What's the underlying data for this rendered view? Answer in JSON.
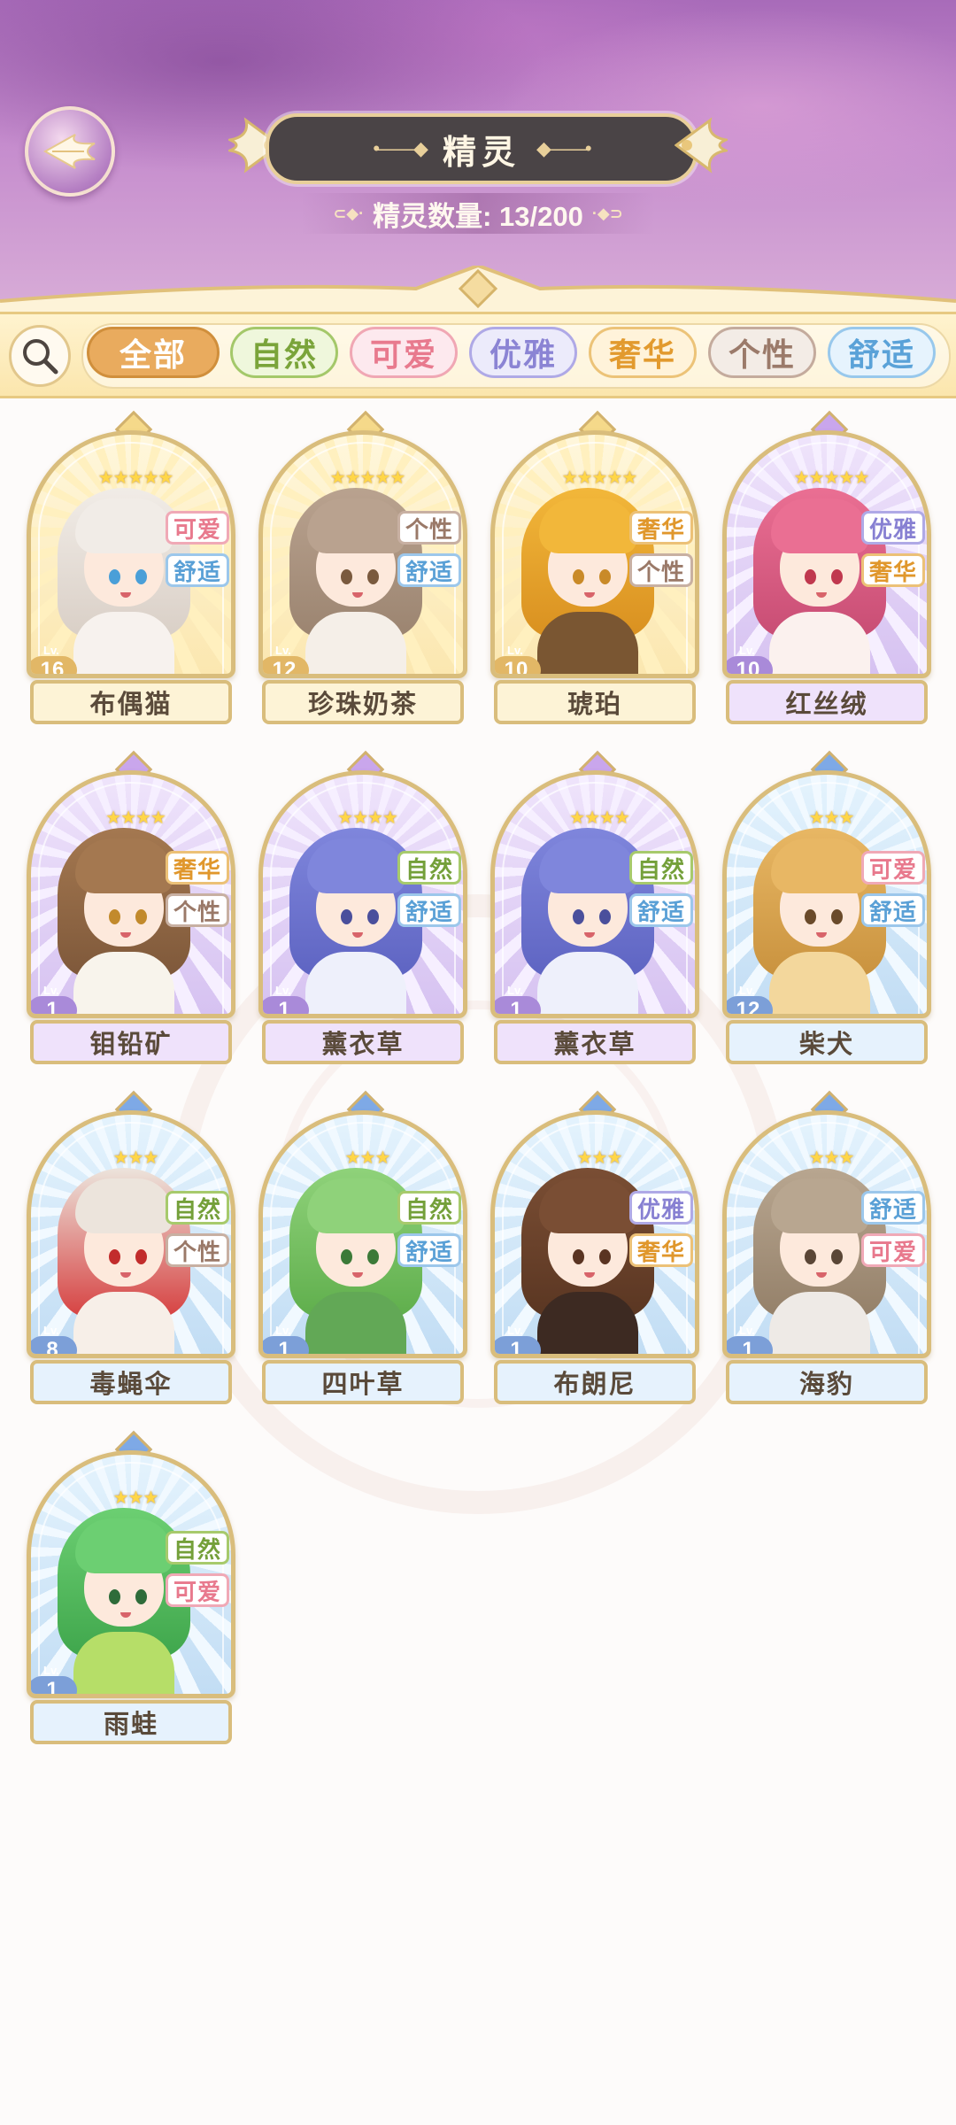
{
  "header": {
    "title": "精灵",
    "count_label": "精灵数量: 13/200"
  },
  "filters": {
    "items": [
      {
        "label": "全部",
        "text": "#ffffff",
        "bg": "#e9ab5e",
        "border": "#d08f3c"
      },
      {
        "label": "自然",
        "text": "#7aa43a",
        "bg": "#eff7dc",
        "border": "#a4c86a"
      },
      {
        "label": "可爱",
        "text": "#e87a8e",
        "bg": "#fde9ee",
        "border": "#f0a7b4"
      },
      {
        "label": "优雅",
        "text": "#8b84d4",
        "bg": "#ecebfb",
        "border": "#afa9e6"
      },
      {
        "label": "奢华",
        "text": "#e29a2e",
        "bg": "#fff3da",
        "border": "#ecc378"
      },
      {
        "label": "个性",
        "text": "#9b7a6a",
        "bg": "#f3ece6",
        "border": "#c4ab9d"
      },
      {
        "label": "舒适",
        "text": "#5aa2d8",
        "bg": "#e6f3fd",
        "border": "#98c8ec"
      }
    ]
  },
  "tag_colors": {
    "可爱": {
      "text": "#e8798d",
      "border": "#f0a9b6"
    },
    "舒适": {
      "text": "#5aa0d6",
      "border": "#9cc7eb"
    },
    "个性": {
      "text": "#9a7968",
      "border": "#c8b0a2"
    },
    "奢华": {
      "text": "#e0972c",
      "border": "#ecc177"
    },
    "优雅": {
      "text": "#8780d2",
      "border": "#afa9e6"
    },
    "自然": {
      "text": "#74a03a",
      "border": "#a7ca6c"
    }
  },
  "spirits": [
    {
      "name": "布偶猫",
      "level": "16",
      "stars": "★★★★★",
      "tags": [
        "可爱",
        "舒适"
      ],
      "rarity": "gold",
      "hair": "#f1ece7",
      "hair_shade": "#d9cfc6",
      "eye": "#4a9fd8",
      "body": "#f7f2ee"
    },
    {
      "name": "珍珠奶茶",
      "level": "12",
      "stars": "★★★★★",
      "tags": [
        "个性",
        "舒适"
      ],
      "rarity": "gold",
      "hair": "#b9a28f",
      "hair_shade": "#9b8470",
      "eye": "#7a5a3e",
      "body": "#f5efe8"
    },
    {
      "name": "琥珀",
      "level": "10",
      "stars": "★★★★★",
      "tags": [
        "奢华",
        "个性"
      ],
      "rarity": "gold",
      "hair": "#f2b73a",
      "hair_shade": "#d99020",
      "eye": "#c98a28",
      "body": "#7a5632"
    },
    {
      "name": "红丝绒",
      "level": "10",
      "stars": "★★★★★",
      "tags": [
        "优雅",
        "奢华"
      ],
      "rarity": "purple",
      "hair": "#ea6f93",
      "hair_shade": "#c84d74",
      "eye": "#c0384e",
      "body": "#fbf1ee"
    },
    {
      "name": "钼铅矿",
      "level": "1",
      "stars": "★★★★",
      "tags": [
        "奢华",
        "个性"
      ],
      "rarity": "purple",
      "hair": "#a47850",
      "hair_shade": "#7e583a",
      "eye": "#c28a2c",
      "body": "#f8f4ec"
    },
    {
      "name": "薰衣草",
      "level": "1",
      "stars": "★★★★",
      "tags": [
        "自然",
        "舒适"
      ],
      "rarity": "purple",
      "hair": "#7f86dc",
      "hair_shade": "#5e64c2",
      "eye": "#4a4f9c",
      "body": "#eef0fb"
    },
    {
      "name": "薰衣草",
      "level": "1",
      "stars": "★★★★",
      "tags": [
        "自然",
        "舒适"
      ],
      "rarity": "purple",
      "hair": "#7f86dc",
      "hair_shade": "#5e64c2",
      "eye": "#4a4f9c",
      "body": "#eef0fb"
    },
    {
      "name": "柴犬",
      "level": "12",
      "stars": "★★★",
      "tags": [
        "可爱",
        "舒适"
      ],
      "rarity": "blue",
      "hair": "#e8b764",
      "hair_shade": "#c9923e",
      "eye": "#6a4a2a",
      "body": "#f3d79c"
    },
    {
      "name": "毒蝇伞",
      "level": "8",
      "stars": "★★★",
      "tags": [
        "自然",
        "个性"
      ],
      "rarity": "blue",
      "hair": "#ece4dc",
      "hair_shade": "#d64040",
      "eye": "#c22c2c",
      "body": "#f7efe8"
    },
    {
      "name": "四叶草",
      "level": "1",
      "stars": "★★★",
      "tags": [
        "自然",
        "舒适"
      ],
      "rarity": "blue",
      "hair": "#8fd27a",
      "hair_shade": "#5fae4c",
      "eye": "#3c7a38",
      "body": "#62a856"
    },
    {
      "name": "布朗尼",
      "level": "1",
      "stars": "★★★",
      "tags": [
        "优雅",
        "奢华"
      ],
      "rarity": "blue",
      "hair": "#7a4e34",
      "hair_shade": "#5a3622",
      "eye": "#5a3422",
      "body": "#3d2a22"
    },
    {
      "name": "海豹",
      "level": "1",
      "stars": "★★★",
      "tags": [
        "舒适",
        "可爱"
      ],
      "rarity": "blue",
      "hair": "#b8a690",
      "hair_shade": "#948069",
      "eye": "#5a4636",
      "body": "#eeeae6"
    },
    {
      "name": "雨蛙",
      "level": "1",
      "stars": "★★★",
      "tags": [
        "自然",
        "可爱"
      ],
      "rarity": "blue",
      "hair": "#6ccf72",
      "hair_shade": "#3fa64c",
      "eye": "#2e6c3a",
      "body": "#b6de68"
    }
  ]
}
